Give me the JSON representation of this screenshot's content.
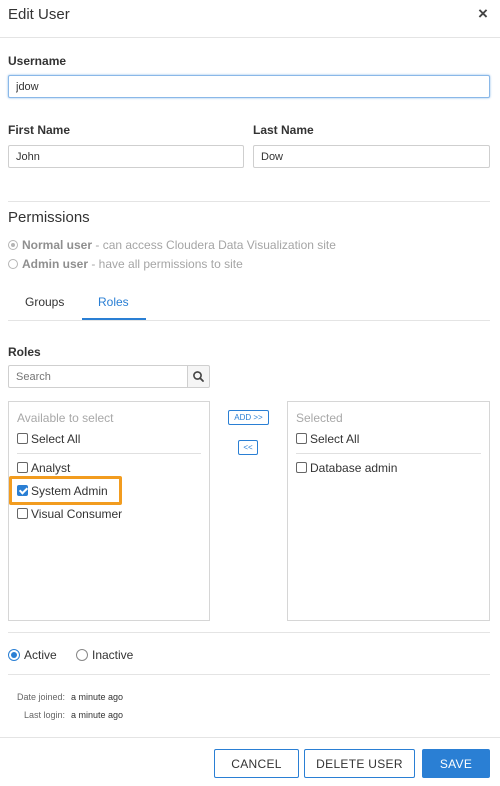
{
  "dialog": {
    "title": "Edit User",
    "close_glyph": "×",
    "close_icon": "close-icon"
  },
  "form": {
    "username_label": "Username",
    "username_value": "jdow",
    "first_name_label": "First Name",
    "first_name_value": "John",
    "last_name_label": "Last Name",
    "last_name_value": "Dow"
  },
  "permissions": {
    "heading": "Permissions",
    "normal": {
      "bold": "Normal user",
      "desc": " - can access Cloudera Data Visualization site",
      "selected": true
    },
    "admin": {
      "bold": "Admin user",
      "desc": " - have all permissions to site",
      "selected": false
    }
  },
  "tabs": [
    {
      "label": "Groups",
      "active": false
    },
    {
      "label": "Roles",
      "active": true
    }
  ],
  "roles": {
    "heading": "Roles",
    "search_placeholder": "Search",
    "search_icon": "search-icon",
    "available": {
      "header": "Available to select",
      "select_all": "Select All",
      "items": [
        {
          "label": "Analyst",
          "checked": false
        },
        {
          "label": "System Admin",
          "checked": true,
          "highlighted": true
        },
        {
          "label": "Visual Consumer",
          "checked": false
        }
      ]
    },
    "add_button": "ADD >>",
    "remove_button": "<<",
    "selected": {
      "header": "Selected",
      "select_all": "Select All",
      "items": [
        {
          "label": "Database admin",
          "checked": false
        }
      ]
    }
  },
  "status": {
    "active_label": "Active",
    "inactive_label": "Inactive",
    "active_selected": true
  },
  "meta": {
    "date_joined_label": "Date joined:",
    "date_joined_value": "a minute ago",
    "last_login_label": "Last login:",
    "last_login_value": "a minute ago"
  },
  "buttons": {
    "cancel": "CANCEL",
    "delete": "DELETE USER",
    "save": "SAVE"
  },
  "colors": {
    "accent": "#2a7fd4",
    "highlight": "#f29c1f",
    "divider": "#e4e4e4"
  }
}
